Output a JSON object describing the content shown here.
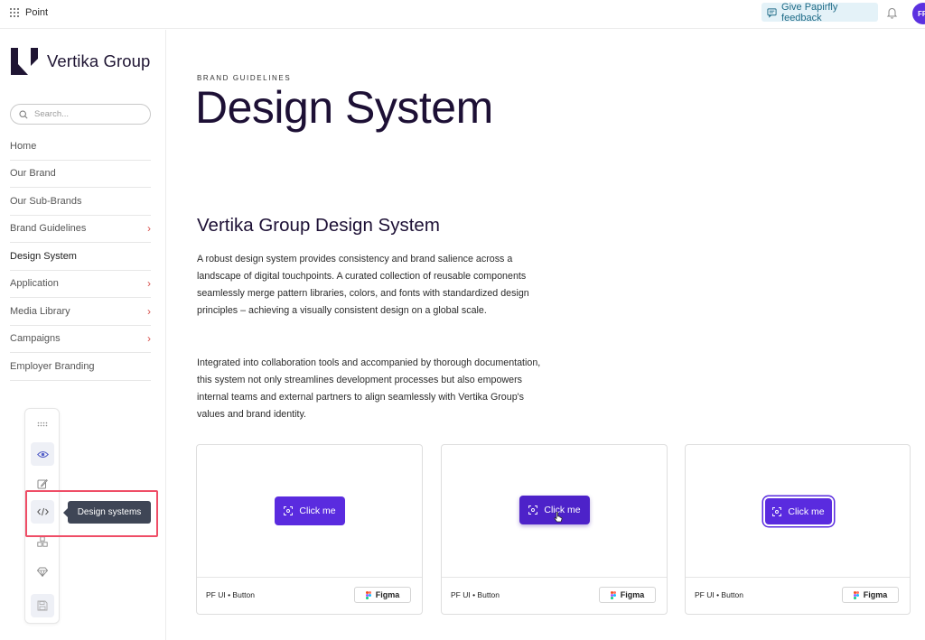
{
  "topbar": {
    "app_name": "Point",
    "feedback_label": "Give Papirfly feedback",
    "avatar_initials": "FF"
  },
  "sidebar": {
    "logo_text": "Vertika Group",
    "search_placeholder": "Search...",
    "items": [
      {
        "label": "Home",
        "has_children": false
      },
      {
        "label": "Our Brand",
        "has_children": false
      },
      {
        "label": "Our Sub-Brands",
        "has_children": false
      },
      {
        "label": "Brand Guidelines",
        "has_children": true
      },
      {
        "label": "Design System",
        "has_children": false,
        "active": true
      },
      {
        "label": "Application",
        "has_children": true
      },
      {
        "label": "Media Library",
        "has_children": true
      },
      {
        "label": "Campaigns",
        "has_children": true
      },
      {
        "label": "Employer Branding",
        "has_children": false
      }
    ]
  },
  "palette": {
    "tooltip": "Design systems",
    "icons": [
      "drag-handle-icon",
      "eye-icon",
      "edit-icon",
      "code-icon",
      "components-icon",
      "diamond-icon",
      "save-icon"
    ]
  },
  "main": {
    "eyebrow": "BRAND GUIDELINES",
    "title": "Design System",
    "section_title": "Vertika Group Design System",
    "paragraph_1": "A robust design system provides consistency and brand salience across a landscape of digital touchpoints. A curated collection of reusable components seamlessly merge pattern libraries, colors, and fonts with standardized design principles – achieving a visually consistent design on a global scale.",
    "paragraph_2": "Integrated into collaboration tools and accompanied by thorough documentation, this system not only streamlines development processes but also empowers internal teams and external partners to align seamlessly with Vertika Group's values and brand identity."
  },
  "cards": [
    {
      "button_label": "Click me",
      "state": "default",
      "footer_label": "PF UI • Button",
      "figma_label": "Figma"
    },
    {
      "button_label": "Click me",
      "state": "hover",
      "footer_label": "PF UI • Button",
      "figma_label": "Figma"
    },
    {
      "button_label": "Click me",
      "state": "focus",
      "footer_label": "PF UI • Button",
      "figma_label": "Figma"
    }
  ],
  "colors": {
    "brand_purple": "#5a2bdf",
    "heading": "#1d1035",
    "chevron": "#d8534f",
    "highlight": "#ef4d66",
    "tooltip_bg": "#3f4656"
  }
}
